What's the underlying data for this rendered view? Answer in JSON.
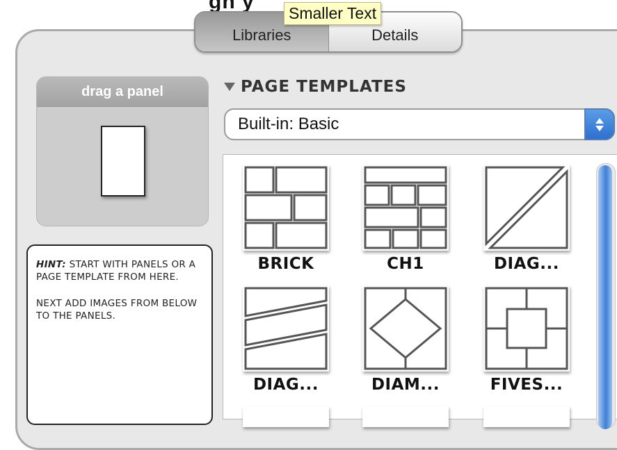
{
  "top_clipped_text": "     gn     y",
  "tabs": [
    {
      "label": "Libraries",
      "active": true
    },
    {
      "label": "Details",
      "active": false
    }
  ],
  "tooltip": "Smaller Text",
  "drag_panel": {
    "header": "drag a panel"
  },
  "hint": {
    "label": "HINT:",
    "line1": "START WITH PANELS OR A PAGE TEMPLATE FROM HERE.",
    "line2": "NEXT ADD IMAGES FROM BELOW TO THE PANELS."
  },
  "page_templates": {
    "title": "PAGE TEMPLATES",
    "selected": "Built-in: Basic",
    "templates": [
      {
        "label": "BRICK"
      },
      {
        "label": "CH1"
      },
      {
        "label": "DIAG..."
      },
      {
        "label": "DIAG..."
      },
      {
        "label": "DIAM..."
      },
      {
        "label": "FIVES..."
      }
    ]
  },
  "colors": {
    "accent": "#3f7fd6",
    "tooltip_bg": "#fffec4"
  }
}
